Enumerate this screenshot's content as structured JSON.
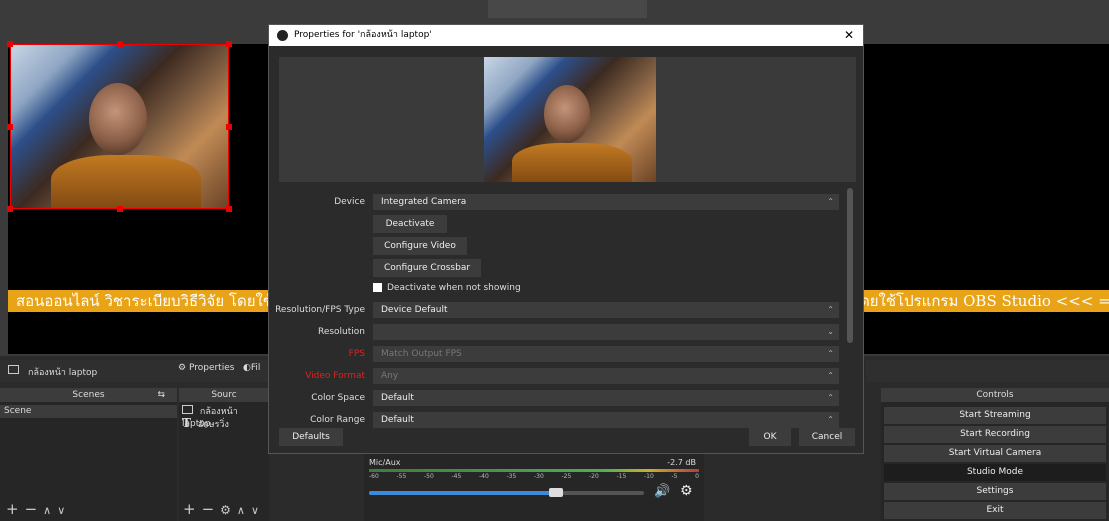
{
  "preview": {
    "ticker_left": "สอนออนไลน์ วิชาระเบียบวิธีวิจัย โดยใช้โป",
    "ticker_right": "ดยใช้โปรแกรม OBS Studio  <<< ===="
  },
  "source_bar": {
    "source_name": "กล้องหน้า laptop",
    "properties_label": "Properties",
    "filters_label": "Fil"
  },
  "scenes": {
    "header": "Scenes",
    "items": [
      "Scene"
    ]
  },
  "sources": {
    "header": "Sourc",
    "items": [
      "กล้องหน้า laptop",
      "อักษรวิ่ง"
    ]
  },
  "mixer": {
    "track_name": "Mic/Aux",
    "level": "-2.7 dB",
    "scale": [
      "-60",
      "-55",
      "-50",
      "-45",
      "-40",
      "-35",
      "-30",
      "-25",
      "-20",
      "-15",
      "-10",
      "-5",
      "0"
    ],
    "volume_fraction": 0.68
  },
  "controls": {
    "header": "Controls",
    "buttons": [
      "Start Streaming",
      "Start Recording",
      "Start Virtual Camera",
      "Studio Mode",
      "Settings",
      "Exit"
    ]
  },
  "dialog": {
    "title": "Properties for 'กล้องหน้า laptop'",
    "device_label": "Device",
    "device_value": "Integrated Camera",
    "deactivate_label": "Deactivate",
    "configure_video_label": "Configure Video",
    "configure_crossbar_label": "Configure Crossbar",
    "deactivate_checkbox_label": "Deactivate when not showing",
    "resfps_label": "Resolution/FPS Type",
    "resfps_value": "Device Default",
    "resolution_label": "Resolution",
    "resolution_value": "",
    "fps_label": "FPS",
    "fps_value": "Match Output FPS",
    "video_format_label": "Video Format",
    "video_format_value": "Any",
    "color_space_label": "Color Space",
    "color_space_value": "Default",
    "color_range_label": "Color Range",
    "color_range_value": "Default",
    "defaults_label": "Defaults",
    "ok_label": "OK",
    "cancel_label": "Cancel"
  },
  "colors": {
    "accent_red": "#e00000",
    "ticker_bg": "#e8a317",
    "mixer_green": "#4caf50",
    "slider_blue": "#3c8ad8"
  }
}
